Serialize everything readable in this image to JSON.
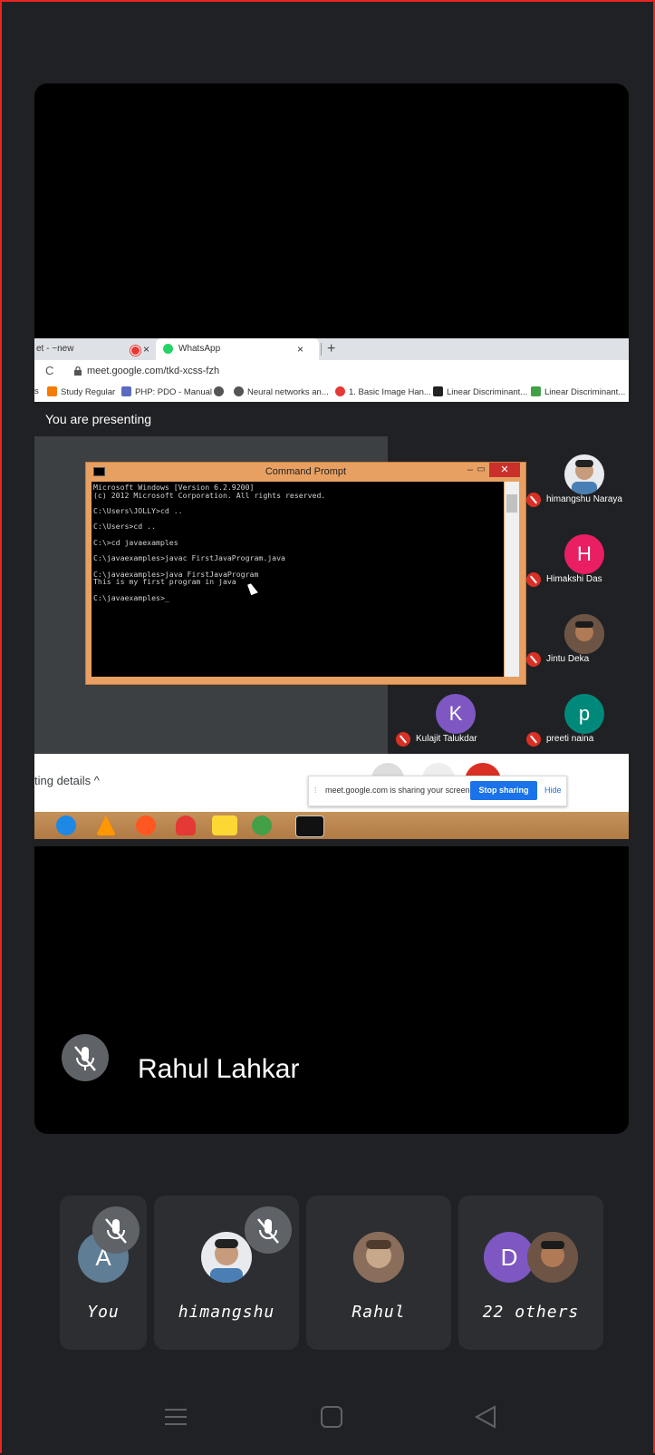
{
  "browser": {
    "tab1_title": "et - ~new",
    "tab2_title": "WhatsApp",
    "tab_close": "×",
    "new_tab": "+",
    "refresh": "C",
    "url": "meet.google.com/tkd-xcss-fzh",
    "bookmarks": [
      {
        "label": "s",
        "color": ""
      },
      {
        "label": "Study Regular",
        "color": "#f57c00"
      },
      {
        "label": "PHP: PDO - Manual",
        "color": "#5c6bc0"
      },
      {
        "label": "",
        "color": "#555"
      },
      {
        "label": "Neural networks an...",
        "color": "#555"
      },
      {
        "label": "1. Basic Image Han...",
        "color": "#e53935"
      },
      {
        "label": "Linear Discriminant...",
        "color": "#222"
      },
      {
        "label": "Linear Discriminant...",
        "color": "#43a047"
      }
    ]
  },
  "presenting_label": "You are presenting",
  "cmd": {
    "title": "Command Prompt",
    "min": "–",
    "max": "▭",
    "close": "✕",
    "lines": [
      "Microsoft Windows [Version 6.2.9200]",
      "(c) 2012 Microsoft Corporation. All rights reserved.",
      "",
      "C:\\Users\\JOLLY>cd ..",
      "",
      "C:\\Users>cd ..",
      "",
      "C:\\>cd javaexamples",
      "",
      "C:\\javaexamples>javac FirstJavaProgram.java",
      "",
      "C:\\javaexamples>java FirstJavaProgram",
      "This is my first program in java",
      "",
      "C:\\javaexamples>_"
    ]
  },
  "inner_participants": [
    {
      "name": "himangshu Naraya",
      "initial": "",
      "color": "#e8eaed"
    },
    {
      "name": "Himakshi Das",
      "initial": "H",
      "color": "#e91e63"
    },
    {
      "name": "Jintu Deka",
      "initial": "",
      "color": "#8d6e63"
    },
    {
      "name": "Kulajit Talukdar",
      "initial": "K",
      "color": "#7e57c2"
    },
    {
      "name": "preeti naina",
      "initial": "p",
      "color": "#00897b"
    }
  ],
  "meeting_details": "ting details  ^",
  "share_popup": {
    "text": "meet.google.com is sharing your screen.",
    "stop": "Stop sharing",
    "hide": "Hide"
  },
  "main_speaker": "Rahul Lahkar",
  "strip": [
    {
      "label": "You",
      "initial": "A",
      "color": "#5f7d95",
      "muted": true
    },
    {
      "label": "himangshu",
      "initial": "",
      "color": "#e8eaed",
      "muted": true
    },
    {
      "label": "Rahul",
      "initial": "",
      "color": "#a1887f",
      "muted": false
    },
    {
      "label": "22 others",
      "initial": "D",
      "color": "#7e57c2",
      "muted": false
    }
  ],
  "nav_icons": [
    "menu-icon",
    "home-icon",
    "back-icon"
  ]
}
